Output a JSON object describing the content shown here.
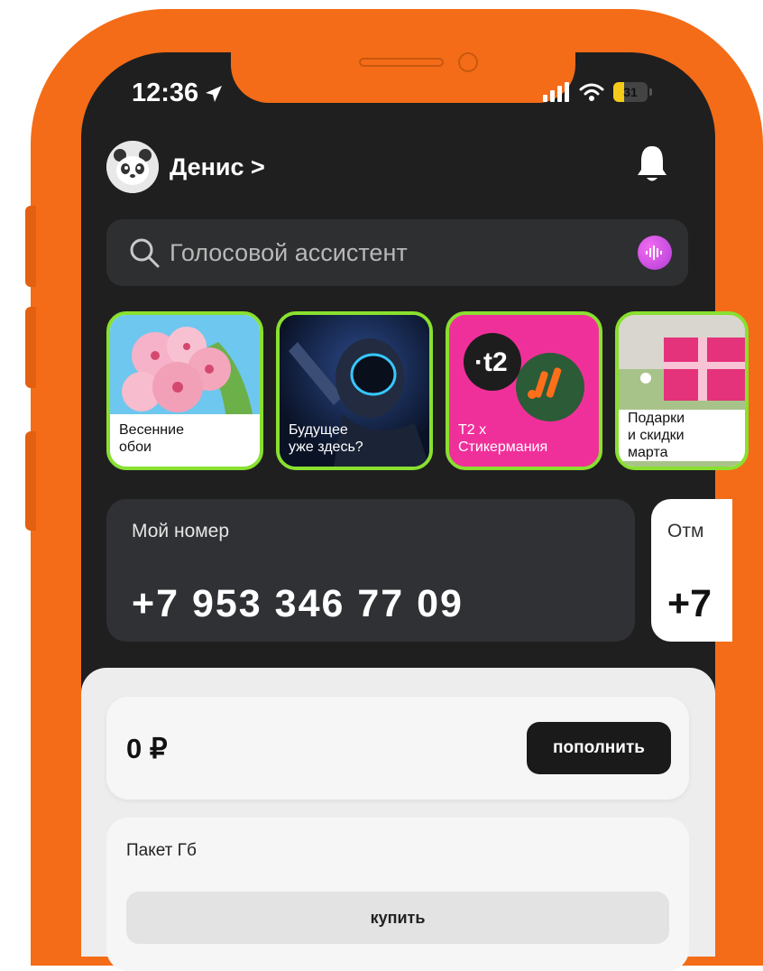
{
  "status_bar": {
    "time": "12:36",
    "battery": "31"
  },
  "header": {
    "user_name": "Денис >"
  },
  "search": {
    "placeholder": "Голосовой ассистент"
  },
  "stories": [
    {
      "label": "Весенние\nобои"
    },
    {
      "label": "Будущее\nуже здесь?"
    },
    {
      "label": "T2 x\nСтикермания"
    },
    {
      "label": "Подарки\nи скидки\nмарта"
    }
  ],
  "number_card": {
    "label": "Мой номер",
    "value": "+7 953 346 77 09"
  },
  "other_card": {
    "label": "Отм",
    "value": "+7"
  },
  "balance": {
    "value": "0 ₽",
    "topup_label": "пополнить"
  },
  "package": {
    "title": "Пакет Гб",
    "buy_label": "купить"
  },
  "colors": {
    "device_frame": "#f46c17",
    "screen_bg": "#1f1f20",
    "story_border": "#89e02f",
    "voice_button": "#d04ee6",
    "t2_card": "#f0309a"
  },
  "icons": [
    "location-arrow-icon",
    "signal-icon",
    "wifi-icon",
    "battery-icon",
    "panda-avatar-icon",
    "bell-icon",
    "search-icon",
    "voice-wave-icon"
  ]
}
